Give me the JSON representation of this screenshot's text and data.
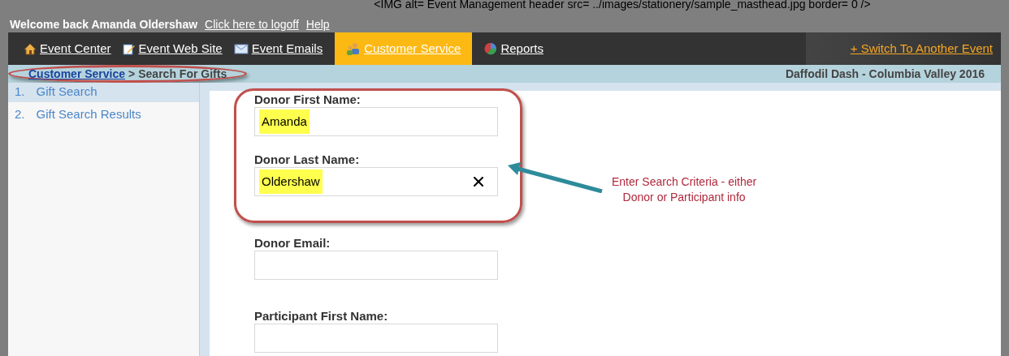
{
  "header_code": "<IMG alt= Event Management header  src= ../images/stationery/sample_masthead.jpg  border= 0  />",
  "welcome": {
    "text": "Welcome back Amanda Oldershaw",
    "links": [
      "Click here to logoff",
      "Help"
    ]
  },
  "nav": {
    "items": [
      {
        "label": "Event Center",
        "selected": false
      },
      {
        "label": "Event Web Site",
        "selected": false
      },
      {
        "label": "Event Emails",
        "selected": false
      },
      {
        "label": "Customer Service",
        "selected": true
      },
      {
        "label": "Reports",
        "selected": false
      }
    ],
    "switch_link": "+ Switch To Another Event"
  },
  "breadcrumb": {
    "link": "Customer Service",
    "separator": ">",
    "current": "Search For Gifts"
  },
  "event_name": "Daffodil Dash - Columbia Valley 2016",
  "sidebar": {
    "items": [
      {
        "number": "1.",
        "label": "Gift Search",
        "selected": true
      },
      {
        "number": "2.",
        "label": "Gift Search Results",
        "selected": false
      }
    ]
  },
  "fields": [
    {
      "label": "Donor First Name:",
      "value": "Amanda",
      "highlighted": true,
      "clear_button": false
    },
    {
      "label": "Donor Last Name:",
      "value": "Oldershaw",
      "highlighted": true,
      "clear_button": true
    },
    {
      "label": "Donor Email:",
      "clear_button": false
    },
    {
      "label": "Participant First Name:",
      "clear_button": false
    }
  ],
  "annotation": {
    "lines": [
      "Enter Search Criteria - either",
      "Donor or Participant info"
    ]
  }
}
